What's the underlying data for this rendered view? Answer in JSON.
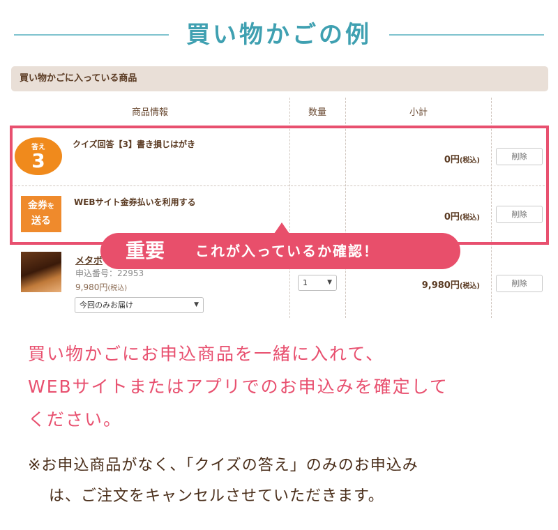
{
  "title": "買い物かごの例",
  "cart_header": "買い物かごに入っている商品",
  "columns": {
    "info": "商品情報",
    "quantity": "数量",
    "subtotal": "小計"
  },
  "items": [
    {
      "badge_small": "答え",
      "badge_big": "3",
      "name": "クイズ回答【3】書き損じはがき",
      "price": "0円",
      "tax": "(税込)",
      "delete": "削除"
    },
    {
      "badge_line1": "金券",
      "badge_particle": "を",
      "badge_line2": "送る",
      "name": "WEBサイト金券払いを利用する",
      "price": "0円",
      "tax": "(税込)",
      "delete": "削除"
    }
  ],
  "product": {
    "name": "メタボ",
    "code": "申込番号：22953",
    "price": "9,980円",
    "price_tax": "(税込)",
    "delivery_option": "今回のみお届け",
    "quantity": "1",
    "subtotal": "9,980円",
    "subtotal_tax": "(税込)",
    "delete": "削除"
  },
  "callout": {
    "strong": "重要",
    "text": "これが入っているか確認！"
  },
  "note_pink": [
    "買い物かごにお申込商品を一緒に入れて、",
    "WEBサイトまたはアプリでのお申込みを確定して",
    "ください。"
  ],
  "note_brown": [
    "※お申込商品がなく、「クイズの答え」のみのお申込み",
    "は、ご注文をキャンセルさせていただきます。"
  ],
  "colors": {
    "accent_pink": "#e8506f",
    "title_teal": "#3fa0b1",
    "badge_orange": "#f08a1c"
  }
}
